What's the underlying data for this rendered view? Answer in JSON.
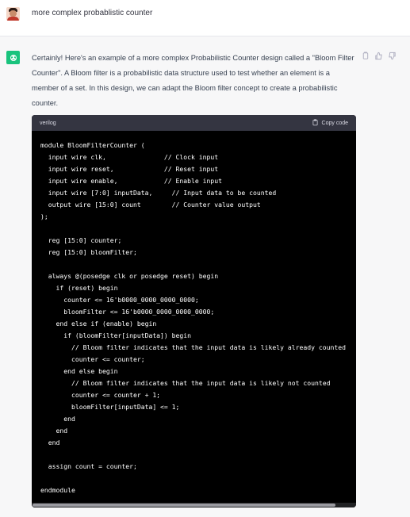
{
  "user": {
    "message": "more complex probablistic counter"
  },
  "assistant": {
    "answer": "Certainly! Here's an example of a more complex Probabilistic Counter design called a \"Bloom Filter Counter\". A Bloom filter is a probabilistic data structure used to test whether an element is a member of a set. In this design, we can adapt the Bloom filter concept to create a probabilistic counter.",
    "actions": [
      "copy-icon",
      "thumbs-up-icon",
      "thumbs-down-icon"
    ]
  },
  "code_block": {
    "language": "verilog",
    "copy_label": "Copy code",
    "code": "module BloomFilterCounter (\n  input wire clk,               // Clock input\n  input wire reset,             // Reset input\n  input wire enable,            // Enable input\n  input wire [7:0] inputData,     // Input data to be counted\n  output wire [15:0] count        // Counter value output\n);\n\n  reg [15:0] counter;\n  reg [15:0] bloomFilter;\n\n  always @(posedge clk or posedge reset) begin\n    if (reset) begin\n      counter <= 16'b0000_0000_0000_0000;\n      bloomFilter <= 16'b0000_0000_0000_0000;\n    end else if (enable) begin\n      if (bloomFilter[inputData]) begin\n        // Bloom filter indicates that the input data is likely already counted\n        counter <= counter;\n      end else begin\n        // Bloom filter indicates that the input data is likely not counted\n        counter <= counter + 1;\n        bloomFilter[inputData] <= 1;\n      end\n    end\n  end\n\n  assign count = counter;\n\nendmodule"
  },
  "colors": {
    "assistant_avatar": "#19c37d",
    "code_background": "#000000",
    "code_header": "#343541"
  }
}
